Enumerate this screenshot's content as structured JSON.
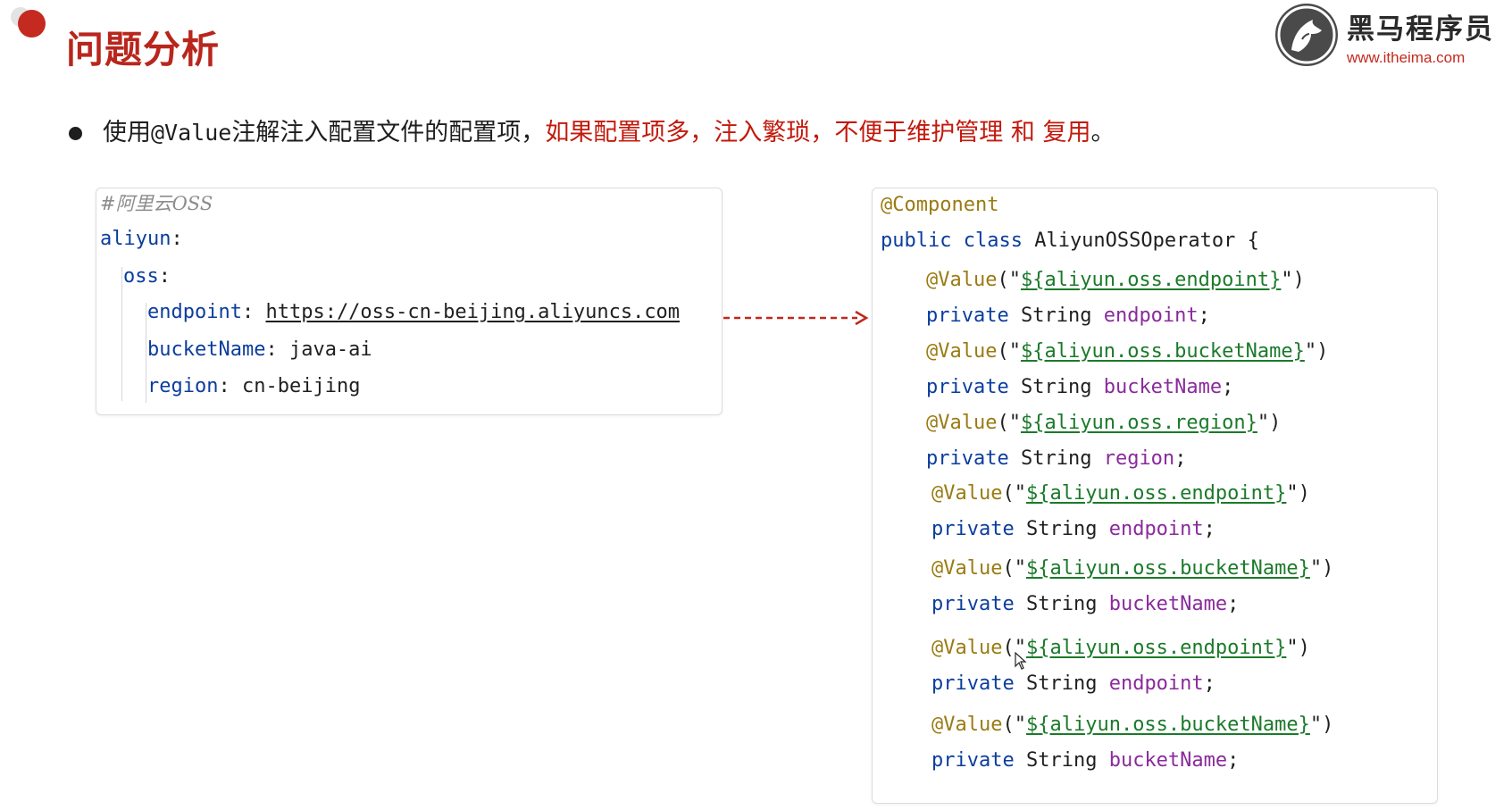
{
  "header": {
    "title": "问题分析",
    "logo_name": "黑马程序员",
    "logo_url": "www.itheima.com"
  },
  "bullet": {
    "text_before": "使用",
    "text_code": "@Value",
    "text_middle": "注解注入配置文件的配置项，",
    "text_highlight": "如果配置项多，注入繁琐，不便于维护管理 和 复用",
    "text_end": "。"
  },
  "yaml": {
    "comment": "#阿里云OSS",
    "root_key": "aliyun",
    "oss_key": "oss",
    "endpoint_key": "endpoint",
    "endpoint_value": "https://oss-cn-beijing.aliyuncs.com",
    "bucket_key": "bucketName",
    "bucket_value": "java-ai",
    "region_key": "region",
    "region_value": "cn-beijing"
  },
  "java": {
    "annotation": "@Component",
    "class_kw": "public class",
    "class_name": "AliyunOSSOperator",
    "brace": "{",
    "members": [
      {
        "ann": "@Value",
        "open": "(\"",
        "expr": "${aliyun.oss.endpoint}",
        "close": "\")",
        "mod": "private",
        "type": "String",
        "field": "endpoint",
        "end": ";"
      },
      {
        "ann": "@Value",
        "open": "(\"",
        "expr": "${aliyun.oss.bucketName}",
        "close": "\")",
        "mod": "private",
        "type": "String",
        "field": "bucketName",
        "end": ";"
      },
      {
        "ann": "@Value",
        "open": "(\"",
        "expr": "${aliyun.oss.region}",
        "close": "\")",
        "mod": "private",
        "type": "String",
        "field": "region",
        "end": ";"
      },
      {
        "ann": "@Value",
        "open": "(\"",
        "expr": "${aliyun.oss.endpoint}",
        "close": "\")",
        "mod": "private",
        "type": "String",
        "field": "endpoint",
        "end": ";"
      },
      {
        "ann": "@Value",
        "open": "(\"",
        "expr": "${aliyun.oss.bucketName}",
        "close": "\")",
        "mod": "private",
        "type": "String",
        "field": "bucketName",
        "end": ";"
      },
      {
        "ann": "@Value",
        "open": "(\"",
        "expr": "${aliyun.oss.endpoint}",
        "close": "\")",
        "mod": "private",
        "type": "String",
        "field": "endpoint",
        "end": ";"
      },
      {
        "ann": "@Value",
        "open": "(\"",
        "expr": "${aliyun.oss.bucketName}",
        "close": "\")",
        "mod": "private",
        "type": "String",
        "field": "bucketName",
        "end": ";"
      }
    ]
  },
  "colors": {
    "title_red": "#b8261d",
    "highlight_red": "#c21a0c",
    "keyword_blue": "#0b3d9e",
    "annotation_olive": "#9a7b12",
    "string_green": "#1b7a2a",
    "field_purple": "#8a2a9c",
    "arrow_red": "#c0281c"
  },
  "icons": [
    "horse-logo-icon",
    "dashed-arrow-icon",
    "mouse-cursor-icon"
  ]
}
